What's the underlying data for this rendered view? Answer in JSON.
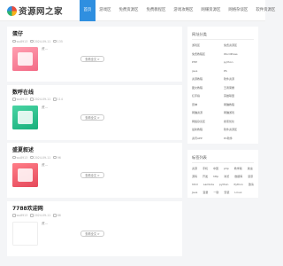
{
  "site": {
    "logo_text": "资源网之家"
  },
  "nav": [
    {
      "label": "首页",
      "active": true
    },
    {
      "label": "游戏区"
    },
    {
      "label": "免费资源区"
    },
    {
      "label": "免费教程区"
    },
    {
      "label": "游戏攻略区"
    },
    {
      "label": "网赚资源区"
    },
    {
      "label": "网络杂谈区"
    },
    {
      "label": "软件资源区"
    }
  ],
  "posts": [
    {
      "title": "蛋仔",
      "author": "wu8913",
      "date": "2024-09-11",
      "views": "135",
      "excerpt": "资...",
      "button": "查看全文 >",
      "thumb": "pink"
    },
    {
      "title": "数呼在线",
      "author": "wu8913",
      "date": "2024-09-11",
      "views": "114",
      "excerpt": "资...",
      "button": "查看全文 >",
      "thumb": "green"
    },
    {
      "title": "盛夏叙述",
      "author": "wu8913",
      "date": "2024-09-11",
      "views": "96",
      "excerpt": "资...",
      "button": "查看全文 >",
      "thumb": "red"
    },
    {
      "title": "7788欢迎网",
      "author": "wu8913",
      "date": "2024-09-11",
      "views": "86",
      "excerpt": "资...",
      "button": "查看全文 >",
      "thumb": "white"
    }
  ],
  "sidebar": {
    "categories_title": "网址分类",
    "categories": [
      "游戏区",
      "免费资源区",
      "免费教程区",
      "WordPress",
      "PHP",
      "python",
      "java",
      "PS",
      "资源教程",
      "软件资源",
      "图文教程",
      "王者荣耀",
      "红手指",
      "英雄联盟",
      "原神",
      "网赚教程",
      "网赚资源",
      "网赚游戏",
      "网络杂谈区",
      "搜索优化",
      "最新教程",
      "软件资源区",
      "资讯APP",
      "PC软件"
    ],
    "tags_title": "标签列表",
    "tags": [
      "资源",
      "手机",
      "中国",
      "php",
      "教学版",
      "爬虫",
      "源码",
      "开发",
      "http",
      "浏览",
      "数据库",
      "复原",
      "html",
      "Lambda",
      "python",
      "Python",
      "邀请",
      "Java",
      "变量",
      "一键",
      "安装",
      "Linux"
    ]
  }
}
